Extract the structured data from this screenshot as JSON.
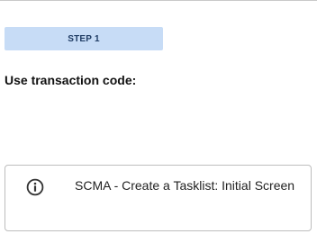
{
  "step": {
    "label": "STEP 1",
    "background_color": "#c7dcf6"
  },
  "instruction": {
    "heading": "Use transaction code:"
  },
  "info_panel": {
    "icon": "info-circle-icon",
    "text": "SCMA - Create a Tasklist: Initial Screen"
  }
}
